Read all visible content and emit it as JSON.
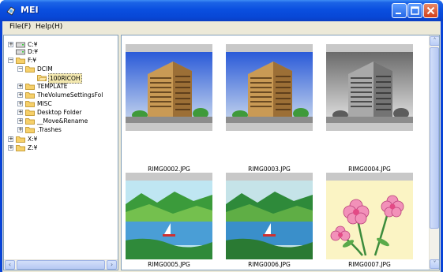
{
  "window": {
    "title": "MEI",
    "icon": "app-icon",
    "controls": [
      "minimize-icon",
      "maximize-icon",
      "close-icon"
    ]
  },
  "menubar": {
    "file": "File(F)",
    "help": "Help(H)"
  },
  "tree": {
    "nodes": {
      "c": {
        "label": "C:¥",
        "icon": "drive-icon",
        "expander": "+"
      },
      "d": {
        "label": "D:¥",
        "icon": "drive-icon",
        "expander": ""
      },
      "f": {
        "label": "F:¥",
        "icon": "folder-icon",
        "expander": "−"
      },
      "dcim": {
        "label": "DCIM",
        "icon": "folder-icon",
        "expander": "−"
      },
      "ricoh": {
        "label": "100RICOH",
        "icon": "folder-open-icon",
        "expander": ""
      },
      "template": {
        "label": "TEMPLATE",
        "icon": "folder-icon",
        "expander": "+"
      },
      "volume": {
        "label": "TheVolumeSettingsFol",
        "icon": "folder-icon",
        "expander": "+"
      },
      "misc": {
        "label": "MISC",
        "icon": "folder-icon",
        "expander": "+"
      },
      "desktop": {
        "label": "Desktop Folder",
        "icon": "folder-icon",
        "expander": "+"
      },
      "move": {
        "label": "__Move&Rename",
        "icon": "folder-icon",
        "expander": "+"
      },
      "trashes": {
        "label": ".Trashes",
        "icon": "folder-icon",
        "expander": "+"
      },
      "x": {
        "label": "X:¥",
        "icon": "folder-icon",
        "expander": "+"
      },
      "z": {
        "label": "Z:¥",
        "icon": "folder-icon",
        "expander": "+"
      }
    }
  },
  "thumbnails": [
    {
      "filename": "RIMG0002.JPG",
      "image": "building-photo-color",
      "icons": [
        "rotate-icon",
        "info-icon"
      ]
    },
    {
      "filename": "RIMG0003.JPG",
      "image": "building-photo-color",
      "icons": [
        "rotate-icon",
        "info-icon"
      ]
    },
    {
      "filename": "RIMG0004.JPG",
      "image": "building-photo-grayscale",
      "icons": [
        "rotate-icon",
        "info-icon"
      ]
    },
    {
      "filename": "RIMG0005.JPG",
      "image": "lake-mountain-photo",
      "icons": []
    },
    {
      "filename": "RIMG0006.JPG",
      "image": "lake-mountain-photo",
      "icons": []
    },
    {
      "filename": "RIMG0007.JPG",
      "image": "pink-flowers-illustration",
      "icons": []
    }
  ],
  "colors": {
    "titlebar": "#0a4fe0",
    "face": "#ece9d8",
    "selection": "#f4e9b0"
  }
}
